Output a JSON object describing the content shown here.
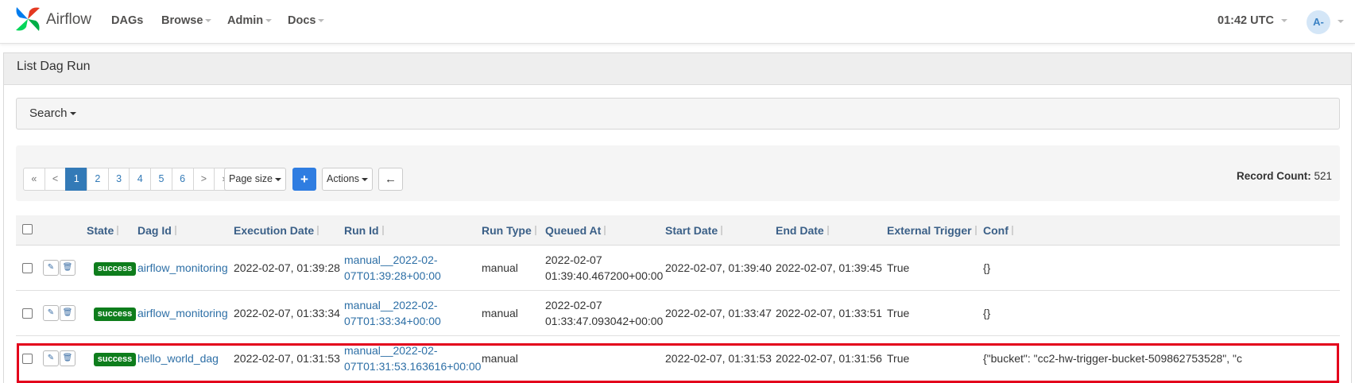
{
  "app": {
    "brand": "Airflow"
  },
  "nav": {
    "items": [
      {
        "label": "DAGs",
        "has_caret": false
      },
      {
        "label": "Browse",
        "has_caret": true
      },
      {
        "label": "Admin",
        "has_caret": true
      },
      {
        "label": "Docs",
        "has_caret": true
      }
    ],
    "clock": "01:42 UTC",
    "avatar": "A-"
  },
  "panel": {
    "title": "List Dag Run"
  },
  "search": {
    "label": "Search"
  },
  "pagination": {
    "first": "«",
    "prev": "<",
    "pages": [
      "1",
      "2",
      "3",
      "4",
      "5",
      "6"
    ],
    "active_page": "1",
    "next": ">",
    "last": "»",
    "page_size_label": "Page size",
    "add_icon": "plus-icon",
    "actions_label": "Actions",
    "back_icon": "arrow-left-icon"
  },
  "record_count": {
    "label": "Record Count:",
    "value": "521"
  },
  "table": {
    "columns": [
      "State",
      "Dag Id",
      "Execution Date",
      "Run Id",
      "Run Type",
      "Queued At",
      "Start Date",
      "End Date",
      "External Trigger",
      "Conf"
    ],
    "rows": [
      {
        "state": "success",
        "dag_id": "airflow_monitoring",
        "execution_date": "2022-02-07, 01:39:28",
        "run_id_line1": "manual__2022-02-",
        "run_id_line2": "07T01:39:28+00:00",
        "run_type": "manual",
        "queued_at_line1": "2022-02-07",
        "queued_at_line2": "01:39:40.467200+00:00",
        "start_date": "2022-02-07, 01:39:40",
        "end_date": "2022-02-07, 01:39:45",
        "external_trigger": "True",
        "conf": "{}"
      },
      {
        "state": "success",
        "dag_id": "airflow_monitoring",
        "execution_date": "2022-02-07, 01:33:34",
        "run_id_line1": "manual__2022-02-",
        "run_id_line2": "07T01:33:34+00:00",
        "run_type": "manual",
        "queued_at_line1": "2022-02-07",
        "queued_at_line2": "01:33:47.093042+00:00",
        "start_date": "2022-02-07, 01:33:47",
        "end_date": "2022-02-07, 01:33:51",
        "external_trigger": "True",
        "conf": "{}"
      },
      {
        "state": "success",
        "dag_id": "hello_world_dag",
        "execution_date": "2022-02-07, 01:31:53",
        "run_id_line1": "manual__2022-02-",
        "run_id_line2": "07T01:31:53.163616+00:00",
        "run_type": "manual",
        "queued_at_line1": "",
        "queued_at_line2": "",
        "start_date": "2022-02-07, 01:31:53",
        "end_date": "2022-02-07, 01:31:56",
        "external_trigger": "True",
        "conf": "{\"bucket\": \"cc2-hw-trigger-bucket-509862753528\", \"c"
      }
    ]
  },
  "colors": {
    "success": "#0e7d1c",
    "highlight": "#e3001b",
    "primary": "#2f7de1",
    "link": "#2d6fa6"
  }
}
